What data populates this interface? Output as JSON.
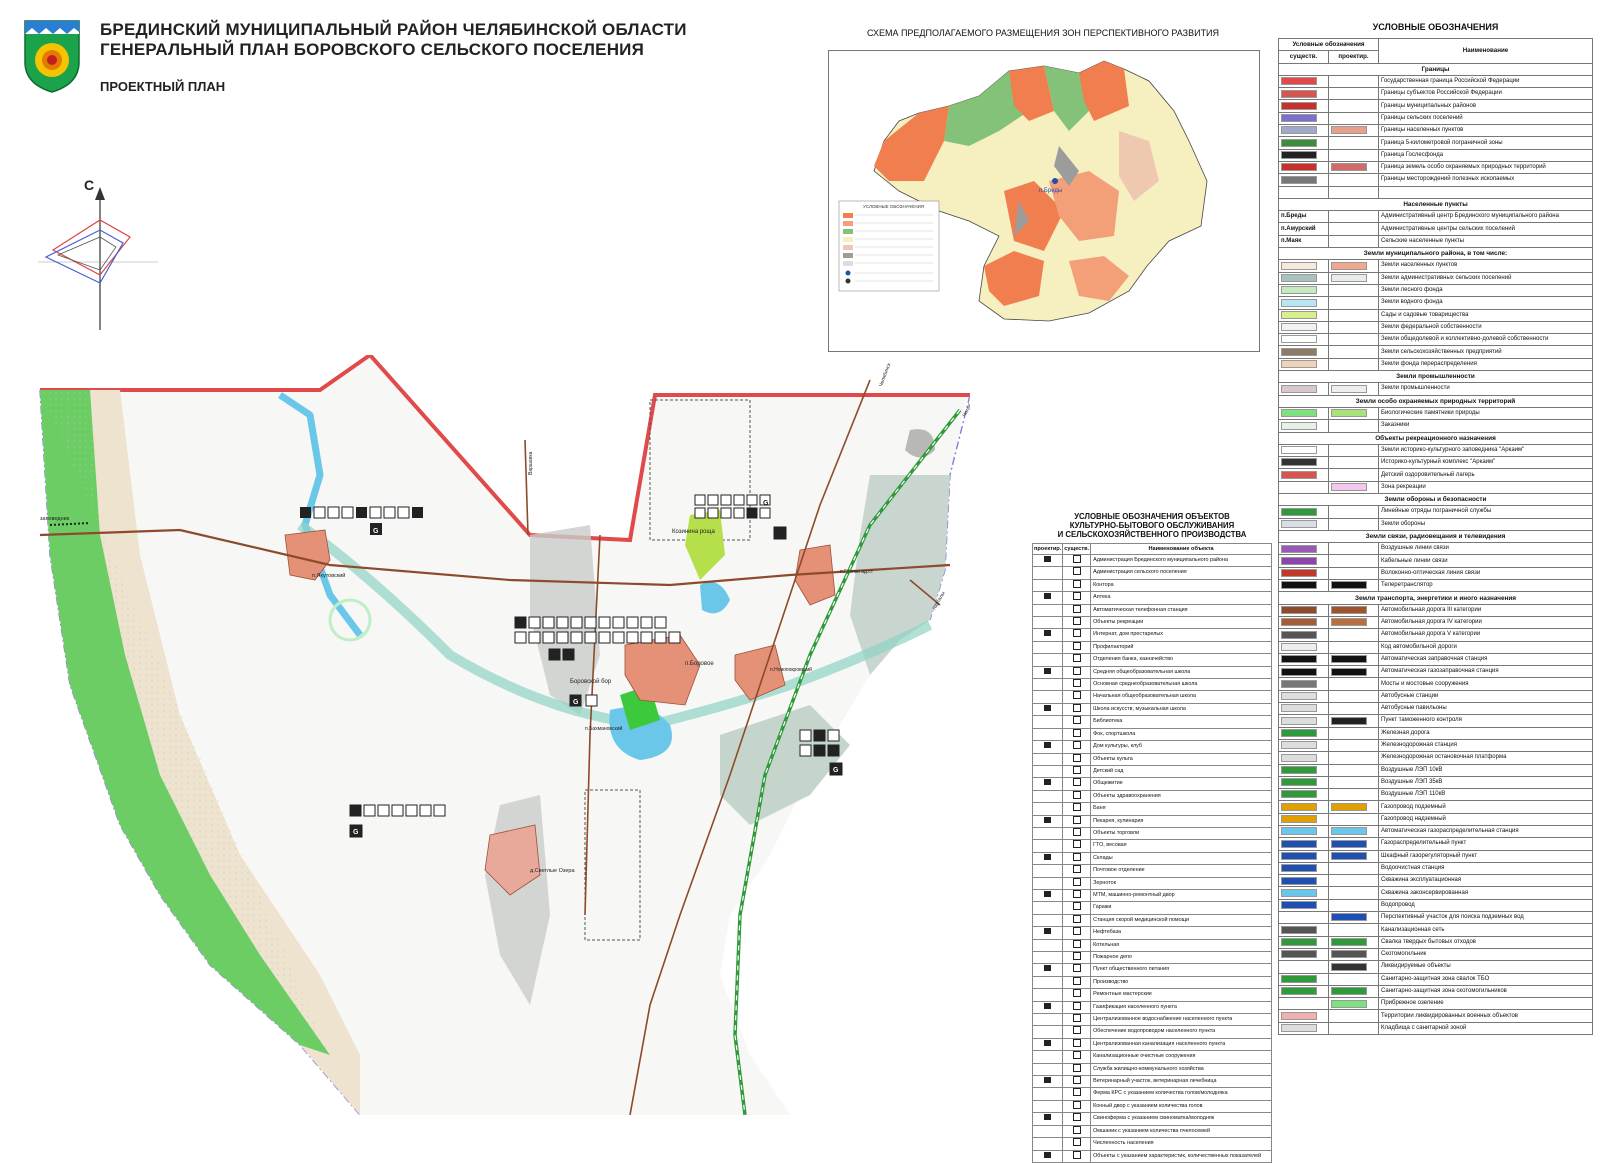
{
  "header": {
    "title_line1": "БРЕДИНСКИЙ МУНИЦИПАЛЬНЫЙ РАЙОН ЧЕЛЯБИНСКОЙ ОБЛАСТИ",
    "title_line2": "ГЕНЕРАЛЬНЫЙ ПЛАН БОРОВСКОГО СЕЛЬСКОГО ПОСЕЛЕНИЯ",
    "subtitle": "ПРОЕКТНЫЙ ПЛАН"
  },
  "compass": {
    "north_letter": "С"
  },
  "inset": {
    "title": "СХЕМА ПРЕДПОЛАГАЕМОГО РАЗМЕЩЕНИЯ ЗОН ПЕРСПЕКТИВНОГО РАЗВИТИЯ",
    "legend_title": "УСЛОВНЫЕ ОБОЗНАЧЕНИЯ",
    "center_label": "п.Бреды"
  },
  "map": {
    "places": {
      "yakutovsky": "п.Якутовский",
      "kozina_rosha": "Козинина роща",
      "borovoe": "п.Боровое",
      "borovskoy_bor": "Боровской бор",
      "novopokrovsky": "п.Новопокровский",
      "glinkovsky": "п.Глинки вд.ст",
      "bakhmanovsky": "п.Бахмановский",
      "svetlye_ozera": "д.Светлые Озера",
      "zapovednik": "заповедник"
    },
    "roads": {
      "varshavka": "Варшавка",
      "chelyabinsk": "Челябинск",
      "kartaly": "Карталы"
    },
    "codes": {
      "g": "G"
    }
  },
  "colors": {
    "border_red": "#e04a4a",
    "forest_green": "#3cc93c",
    "water_blue": "#6bc7ea",
    "settlement": "#e59178",
    "road_brown": "#8c4b2b",
    "rail_green": "#2f9a3a",
    "industrial_grey": "#bcbcbc"
  },
  "mid_legend": {
    "title_lines": [
      "УСЛОВНЫЕ ОБОЗНАЧЕНИЯ ОБЪЕКТОВ",
      "КУЛЬТУРНО-БЫТОВОГО ОБСЛУЖИВАНИЯ",
      "И СЕЛЬСКОХОЗЯЙСТВЕННОГО ПРОИЗВОДСТВА"
    ],
    "columns": [
      "проектир.",
      "существ.",
      "Наименование объекта"
    ],
    "rows": [
      "Администрация Брединского муниципального района",
      "Администрация сельского поселения",
      "Контора",
      "Аптека",
      "Автоматическая телефонная станция",
      "Объекты рекреации",
      "Интернат, дом престарелых",
      "Профилакторий",
      "Отделения банка, казначейство",
      "Средняя общеобразовательная школа",
      "Основная среднеобразовательная школа",
      "Начальная общеобразовательная школа",
      "Школа искусств, музыкальная школа",
      "Библиотека",
      "Фок, спортшкола",
      "Дом культуры, клуб",
      "Объекты культа",
      "Детский сад",
      "Общежитие",
      "Объекты здравоохранения",
      "Баня",
      "Пекарня, кулинария",
      "Объекты торговли",
      "ГТО, весовая",
      "Склады",
      "Почтовое отделение",
      "Зерноток",
      "МТМ, машинно-ремонтный двор",
      "Гаражи",
      "Станция скорой медицинской помощи",
      "Нефтебаза",
      "Котельная",
      "Пожарное депо",
      "Пункт общественного питания",
      "Производство",
      "Ремонтные мастерские",
      "Газификация населенного пункта",
      "Централизованное водоснабжение населенного пункта",
      "Обеспечение водопроводом населенного пункта",
      "Централизованная канализация населенного пункта",
      "Канализационные очистные сооружения",
      "Служба жилищно-коммунального хозяйства",
      "Ветеринарный участок, ветеринарная лечебница",
      "Ферма КРС с указанием количества голов/молодняка",
      "Конный двор с указанием количества голов",
      "Свиноферма с указанием свиноматка/молодняк",
      "Омшаник с указанием количества пчелосемей",
      "Численность населения",
      "Объекты с указанием характеристик, количественных показателей"
    ]
  },
  "right_legend": {
    "title": "УСЛОВНЫЕ ОБОЗНАЧЕНИЯ",
    "col_group": "Условные обозначения",
    "col_exist": "существ.",
    "col_proj": "проектир.",
    "col_name": "Наименование",
    "rows": [
      {
        "section": "Границы"
      },
      {
        "name": "Государственная граница Российской Федерации",
        "c1": "#e04a4a",
        "c2": ""
      },
      {
        "name": "Границы субъектов Российской Федерации",
        "c1": "#d9534f",
        "c2": ""
      },
      {
        "name": "Границы муниципальных районов",
        "c1": "#c9302c",
        "c2": ""
      },
      {
        "name": "Границы сельских поселений",
        "c1": "#7b6fd0",
        "c2": ""
      },
      {
        "name": "Границы населенных пунктов",
        "c1": "#9fa9c9",
        "c2": "#e8a08a"
      },
      {
        "name": "Граница 5-километровой пограничной зоны",
        "c1": "#3b8d3b",
        "c2": ""
      },
      {
        "name": "Граница Гослесфонда",
        "c1": "#222222",
        "c2": ""
      },
      {
        "name": "Граница земель особо охраняемых природных территорий",
        "c1": "#c9302c",
        "c2": "#d36a6a"
      },
      {
        "name": "Границы месторождений полезных ископаемых",
        "c1": "#777777",
        "c2": ""
      },
      {
        "name": "",
        "c1": "",
        "c2": ""
      },
      {
        "section": "Населенные пункты"
      },
      {
        "name": "Административный центр Брединского муниципального района",
        "label": "п.Бреды"
      },
      {
        "name": "Административные центры сельских поселений",
        "label": "п.Амурский"
      },
      {
        "name": "Сельские населенные пункты",
        "label": "п.Маяк"
      },
      {
        "section": "Земли муниципального района, в том числе:"
      },
      {
        "name": "Земли населенных пунктов",
        "c1": "#f5eadb",
        "c2": "#f0a98e"
      },
      {
        "name": "Земли административных сельских поселений",
        "c1": "#a8c3bd",
        "c2": "#e9ede9"
      },
      {
        "name": "Земли лесного фонда",
        "c1": "#c6e9bf",
        "c2": ""
      },
      {
        "name": "Земли водного фонда",
        "c1": "#b8e6f5",
        "c2": ""
      },
      {
        "name": "Сады и садовые товарищества",
        "c1": "#d7f08a",
        "c2": ""
      },
      {
        "name": "Земли федеральной собственности",
        "c1": "#f2f2f2",
        "c2": ""
      },
      {
        "name": "Земли общедолевой и коллективно-долевой собственности",
        "c1": "#ffffff",
        "c2": ""
      },
      {
        "name": "Земли сельскохозяйственных предприятий",
        "c1": "#8d7b63",
        "c2": ""
      },
      {
        "name": "Земли фонда перераспределения",
        "c1": "#f0d2b8",
        "c2": ""
      },
      {
        "section": "Земли промышленности"
      },
      {
        "name": "Земли промышленности",
        "c1": "#d7c8cf",
        "c2": "#eeeeee"
      },
      {
        "section": "Земли особо охраняемых природных территорий"
      },
      {
        "name": "Биологические памятники природы",
        "c1": "#7ee07e",
        "c2": "#a9e27a"
      },
      {
        "name": "Заказники",
        "c1": "#e6f2e6",
        "c2": ""
      },
      {
        "section": "Объекты рекреационного назначения"
      },
      {
        "name": "Земли историко-культурного заповедника \"Аркаим\"",
        "c1": "#ffffff",
        "c2": ""
      },
      {
        "name": "Историко-культурный комплекс \"Аркаим\"",
        "c1": "#333333",
        "c2": ""
      },
      {
        "name": "Детский оздоровительный лагерь",
        "c1": "#d9534f",
        "c2": ""
      },
      {
        "name": "Зона рекреации",
        "c1": "",
        "c2": "#f5c7ef"
      },
      {
        "section": "Земли обороны и безопасности"
      },
      {
        "name": "Линейные отряды пограничной службы",
        "c1": "#2f9a3a",
        "c2": ""
      },
      {
        "name": "Земли обороны",
        "c1": "#d8dde6",
        "c2": ""
      },
      {
        "section": "Земли связи, радиовещания и телевидения"
      },
      {
        "name": "Воздушные линии связи",
        "c1": "#9b59b6",
        "c2": ""
      },
      {
        "name": "Кабельные линии связи",
        "c1": "#8e44ad",
        "c2": ""
      },
      {
        "name": "Волоконно-оптическая линия связи",
        "c1": "#c0392b",
        "c2": ""
      },
      {
        "name": "Телеретранслятор",
        "c1": "#111111",
        "c2": "#111111"
      },
      {
        "section": "Земли транспорта, энергетики и иного назначения"
      },
      {
        "name": "Автомобильная дорога III категории",
        "c1": "#8c4b2b",
        "c2": "#a0522d"
      },
      {
        "name": "Автомобильная дорога IV категории",
        "c1": "#a65d35",
        "c2": "#b87040"
      },
      {
        "name": "Автомобильная дорога V категории",
        "c1": "#555555",
        "c2": ""
      },
      {
        "name": "Код автомобильной дороги",
        "c1": "#eeeeee",
        "c2": ""
      },
      {
        "name": "Автоматическая заправочная станция",
        "c1": "#111111",
        "c2": "#111111"
      },
      {
        "name": "Автоматическая газозаправочная станция",
        "c1": "#111111",
        "c2": "#111111"
      },
      {
        "name": "Мосты и мостовые сооружения",
        "c1": "#777777",
        "c2": ""
      },
      {
        "name": "Автобусные станции",
        "c1": "#dddddd",
        "c2": ""
      },
      {
        "name": "Автобусные павильоны",
        "c1": "#dddddd",
        "c2": ""
      },
      {
        "name": "Пункт таможенного контроля",
        "c1": "#dddddd",
        "c2": "#222222"
      },
      {
        "name": "Железная дорога",
        "c1": "#2f9a3a",
        "c2": ""
      },
      {
        "name": "Железнодорожная станция",
        "c1": "#dddddd",
        "c2": ""
      },
      {
        "name": "Железнодорожная остановочная платформа",
        "c1": "#dddddd",
        "c2": ""
      },
      {
        "name": "Воздушные ЛЭП 10кВ",
        "c1": "#2f9a3a",
        "c2": ""
      },
      {
        "name": "Воздушные ЛЭП 35кВ",
        "c1": "#2f9a3a",
        "c2": ""
      },
      {
        "name": "Воздушные ЛЭП 110кВ",
        "c1": "#2f9a3a",
        "c2": ""
      },
      {
        "name": "Газопровод подземный",
        "c1": "#e0a000",
        "c2": "#e0a000"
      },
      {
        "name": "Газопровод надземный",
        "c1": "#e0a000",
        "c2": ""
      },
      {
        "name": "Автоматическая газораспределительная станция",
        "c1": "#6bc7ea",
        "c2": "#6bc7ea"
      },
      {
        "name": "Газораспределительный пункт",
        "c1": "#1f4fb0",
        "c2": "#1f4fb0"
      },
      {
        "name": "Шкафный газорегуляторный пункт",
        "c1": "#1f4fb0",
        "c2": "#1f4fb0"
      },
      {
        "name": "Водоочистная станция",
        "c1": "#1f4fb0",
        "c2": ""
      },
      {
        "name": "Скважина эксплуатационная",
        "c1": "#1f4fb0",
        "c2": ""
      },
      {
        "name": "Скважина законсервированная",
        "c1": "#6bc7ea",
        "c2": ""
      },
      {
        "name": "Водопровод",
        "c1": "#1f4fb0",
        "c2": ""
      },
      {
        "name": "Перспективный участок для поиска подземных вод",
        "c1": "",
        "c2": "#1f4fb0"
      },
      {
        "name": "Канализационная сеть",
        "c1": "#555555",
        "c2": ""
      },
      {
        "name": "Свалка твердых бытовых отходов",
        "c1": "#2f9a3a",
        "c2": "#2f9a3a"
      },
      {
        "name": "Скотомогильник",
        "c1": "#555555",
        "c2": "#555555"
      },
      {
        "name": "Ликвидируемые объекты",
        "c1": "",
        "c2": "#333333"
      },
      {
        "name": "Санитарно-защитная зона свалок ТБО",
        "c1": "#2f9a3a",
        "c2": ""
      },
      {
        "name": "Санитарно-защитная зона скотомогильников",
        "c1": "#2f9a3a",
        "c2": "#2f9a3a"
      },
      {
        "name": "Прибрежное озеление",
        "c1": "",
        "c2": "#7ee07e"
      },
      {
        "name": "Территории ликвидированных военных объектов",
        "c1": "#f0b0b0",
        "c2": ""
      },
      {
        "name": "Кладбища с санитарной зоной",
        "c1": "#dddddd",
        "c2": ""
      }
    ]
  }
}
